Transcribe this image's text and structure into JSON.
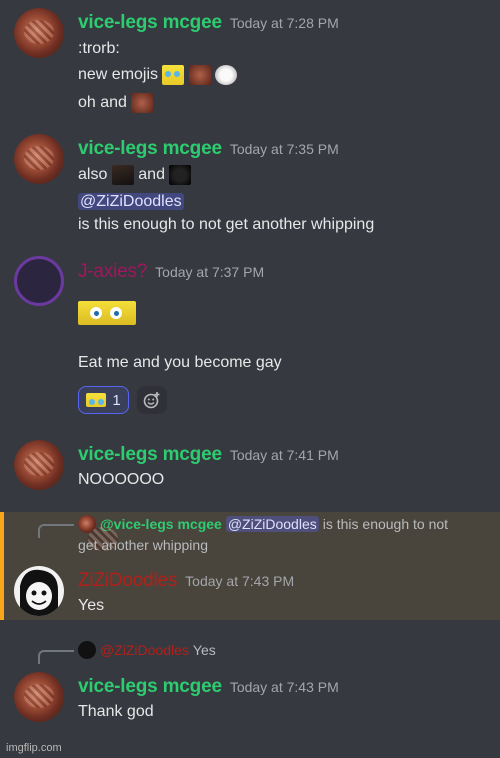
{
  "messages": [
    {
      "username": "vice-legs mcgee",
      "timestamp": "Today at 7:28 PM",
      "lines": [
        ":trorb:",
        "new emojis",
        "oh and"
      ]
    },
    {
      "username": "vice-legs mcgee",
      "timestamp": "Today at 7:35 PM",
      "lines": [
        "also",
        "and",
        "@ZiZiDoodles",
        "is this enough to not get another whipping"
      ]
    },
    {
      "username": "J-axies?",
      "timestamp": "Today at 7:37 PM",
      "lines": [
        "Eat me and you become gay"
      ],
      "reaction_count": "1"
    },
    {
      "username": "vice-legs mcgee",
      "timestamp": "Today at 7:41 PM",
      "lines": [
        "NOOOOOO"
      ]
    },
    {
      "reply_to": {
        "username": "@vice-legs mcgee",
        "mention": "@ZiZiDoodles",
        "text_1": "is this enough to not",
        "text_2": "get another whipping"
      },
      "username": "ZiZiDoodles",
      "timestamp": "Today at 7:43 PM",
      "lines": [
        "Yes"
      ]
    },
    {
      "reply_to": {
        "username": "@ZiZiDoodles",
        "text_1": "Yes"
      },
      "username": "vice-legs mcgee",
      "timestamp": "Today at 7:43 PM",
      "lines": [
        "Thank god"
      ]
    }
  ],
  "watermark": "imgflip.com",
  "colors": {
    "background": "#36393f",
    "username_green": "#2ecc71",
    "username_jaxies": "#a3165f",
    "username_zizi": "#b3201a",
    "mention_bg": "#5865f2",
    "highlight_bar": "#faa61a"
  }
}
